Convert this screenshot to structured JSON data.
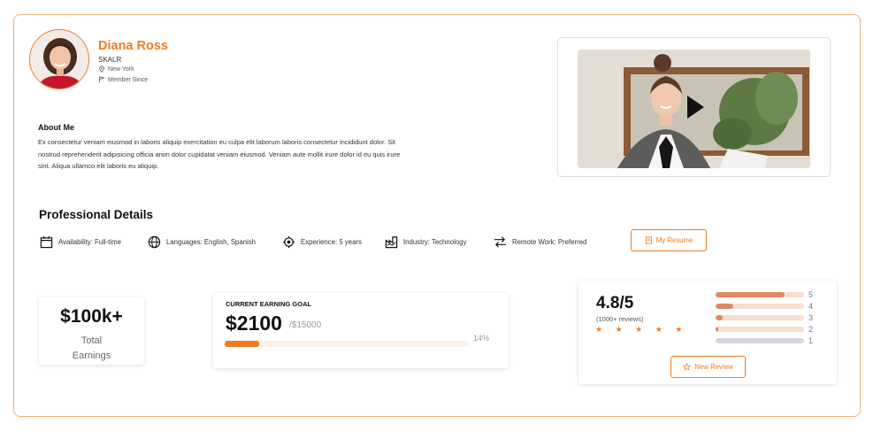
{
  "profile": {
    "name": "Diana Ross",
    "company": "SKALR",
    "location": "New York",
    "member_since": "Member Since"
  },
  "about": {
    "heading": "About Me",
    "text": "Ex consectetur veniam eiusmod in laboris aliquip exercitation eu culpa elit laborum laboris consectetur incididunt dolor. Sit nostrud reprehenderit adipisicing officia anim dolor cupidatat veniam eiusmod. Veniam aute mollit irure dolor id eu quis irure sint. Aliqua ullamco elit laboris eu aliquip."
  },
  "professional": {
    "heading": "Professional Details",
    "availability": "Availability: Full-time",
    "languages": "Languages: English, Spanish",
    "experience": "Experience: 5 years",
    "industry": "Industry: Technology",
    "remote": "Remote Work: Preferred",
    "resume_button": "My Resume"
  },
  "earnings": {
    "value": "$100k+",
    "label_line1": "Total",
    "label_line2": "Earnings"
  },
  "goal": {
    "heading": "CURRENT EARNING GOAL",
    "value": "$2100",
    "target": "/$15000",
    "percent_label": "14%",
    "progress": 0.14
  },
  "rating": {
    "score": "4.8/5",
    "count": "(1000+ reviews)",
    "stars": "★ ★ ★ ★ ★",
    "distribution": [
      {
        "label": "5",
        "fraction": 0.78
      },
      {
        "label": "4",
        "fraction": 0.2
      },
      {
        "label": "3",
        "fraction": 0.08
      },
      {
        "label": "2",
        "fraction": 0.03
      },
      {
        "label": "1",
        "fraction": 0.0
      }
    ],
    "review_button": "New Review"
  },
  "colors": {
    "accent": "#ef7c22",
    "bar_fill": "#dd8a63",
    "bar_track": "#f8ddd0",
    "bar_empty": "#d3d6dd"
  },
  "icons": {
    "location": "location-pin-icon",
    "member": "flag-icon",
    "availability": "calendar-icon",
    "languages": "globe-icon",
    "experience": "experience-icon",
    "industry": "industry-icon",
    "remote": "arrows-icon",
    "resume": "document-icon",
    "review": "star-icon",
    "play": "play-icon"
  }
}
